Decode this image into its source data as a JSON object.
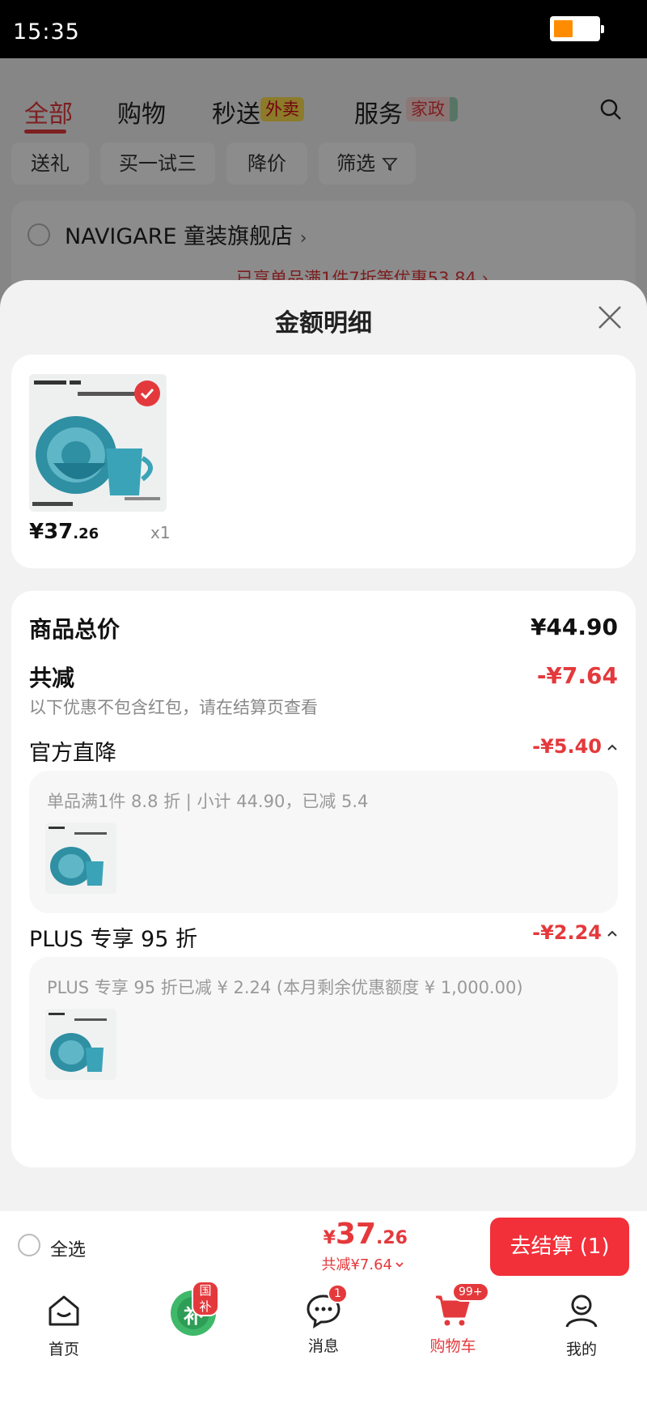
{
  "status_bar": {
    "time": "15:35",
    "battery_level": 0.45
  },
  "top_tabs": [
    {
      "label": "全部",
      "active": true
    },
    {
      "label": "购物"
    },
    {
      "label": "秒送",
      "tag": "外卖"
    },
    {
      "label": "服务",
      "tag": "家政"
    }
  ],
  "filter_chips": [
    "送礼",
    "买一试三",
    "降价",
    "筛选"
  ],
  "store": {
    "name": "NAVIGARE 童装旗舰店",
    "arrow": "›",
    "promo": "已享单品满1件7折等优惠53.84 ›"
  },
  "sheet": {
    "title": "金额明细",
    "product": {
      "price_currency": "¥",
      "price_int": "37",
      "price_dec": ".26",
      "qty": "x1"
    },
    "summary": {
      "total_label": "商品总价",
      "total_value": "¥44.90",
      "discount_label": "共减",
      "discount_value": "-¥7.64",
      "discount_note": "以下优惠不包含红包，请在结算页查看",
      "official": {
        "label": "官方直降",
        "value": "-¥5.40",
        "detail": "单品满1件 8.8 折 | 小计 44.90，已减 5.4"
      },
      "plus": {
        "label": "PLUS 专享 95 折",
        "value": "-¥2.24",
        "detail": "PLUS 专享 95 折已减 ¥ 2.24 (本月剩余优惠额度 ¥ 1,000.00)"
      }
    }
  },
  "checkout": {
    "select_all": "全选",
    "price_currency": "¥",
    "price_int": "37",
    "price_dec": ".26",
    "discount_summary": "共减¥7.64",
    "pay_button": "去结算 (1)"
  },
  "bottom_nav": [
    {
      "label": "首页",
      "icon": "home-icon"
    },
    {
      "label": "",
      "icon": "subsidy-icon",
      "badge": "国补",
      "glyph": "补"
    },
    {
      "label": "消息",
      "icon": "message-icon",
      "badge": "1"
    },
    {
      "label": "购物车",
      "icon": "cart-icon",
      "badge": "99+",
      "active": true
    },
    {
      "label": "我的",
      "icon": "profile-icon"
    }
  ],
  "colors": {
    "accent": "#e4393c",
    "pay_button": "#f2303a"
  }
}
